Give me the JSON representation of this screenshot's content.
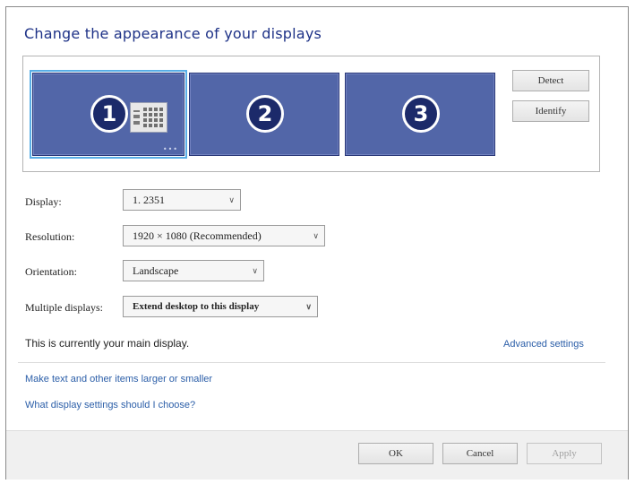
{
  "title": "Change the appearance of your displays",
  "monitors": [
    {
      "number": "1",
      "selected": true
    },
    {
      "number": "2",
      "selected": false
    },
    {
      "number": "3",
      "selected": false
    }
  ],
  "side_buttons": {
    "detect": "Detect",
    "identify": "Identify"
  },
  "fields": {
    "display": {
      "label": "Display:",
      "value": "1. 2351"
    },
    "resolution": {
      "label": "Resolution:",
      "value": "1920 × 1080 (Recommended)"
    },
    "orientation": {
      "label": "Orientation:",
      "value": "Landscape"
    },
    "multiple": {
      "label": "Multiple displays:",
      "value": "Extend desktop to this display"
    }
  },
  "info_text": "This is currently your main display.",
  "advanced_link": "Advanced settings",
  "links": {
    "larger_text": "Make text and other items larger or smaller",
    "which_settings": "What display settings should I choose?"
  },
  "footer": {
    "ok": "OK",
    "cancel": "Cancel",
    "apply": "Apply"
  },
  "colors": {
    "title": "#1e3287",
    "monitor": "#5266a8",
    "link": "#2b5ea8",
    "selection": "#58aee6"
  }
}
